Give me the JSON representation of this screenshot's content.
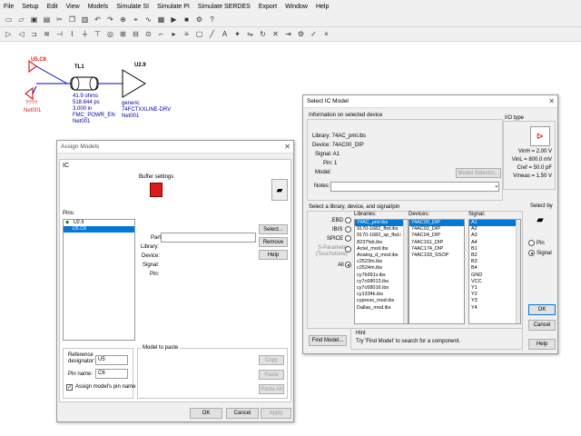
{
  "menu": [
    "File",
    "Setup",
    "Edit",
    "View",
    "Models",
    "Simulate SI",
    "Simulate PI",
    "Simulate SERDES",
    "Export",
    "Window",
    "Help"
  ],
  "schematic": {
    "u5c6": "U5.C6",
    "unknown": "????",
    "net_left": "Net001",
    "tl1": "TL1",
    "tl1_params": [
      "41.9 ohms",
      "518.644 ps",
      "3.000 in",
      "FMC_POWR_EN",
      "Net001"
    ],
    "u29": "U2.9",
    "u29_params": [
      "generic",
      "74FCTXXLINE-DRV",
      "Net001"
    ]
  },
  "assign": {
    "title": "Assign Models",
    "tab": "IC",
    "buffer_settings": "Buffer settings",
    "pins_label": "Pins:",
    "pins": [
      "U2.9",
      "U5.C6"
    ],
    "part": "Part:",
    "library": "Library:",
    "device": "Device:",
    "signal": "Signal:",
    "pin": "Pin:",
    "select_btn": "Select...",
    "remove_btn": "Remove",
    "help_btn": "Help",
    "ref_label": "Reference designator:",
    "ref_value": "U5",
    "pin_name_label": "Pin name:",
    "pin_name_value": "C6",
    "assign_chk": "Assign model's pin name",
    "model_to_paste": "Model to paste",
    "copy_btn": "Copy",
    "paste_btn": "Paste",
    "paste_all_btn": "Paste All",
    "ok": "OK",
    "cancel": "Cancel",
    "apply": "Apply"
  },
  "select": {
    "title": "Select IC Model",
    "info_header": "Information on selected device",
    "library": "Library: 74AC_pml.ibs",
    "device": "Device: 74AC00_DIP",
    "signal": "Signal: A1",
    "pin": "Pin: 1",
    "model": "Model:",
    "model_selector": "Model Selector...",
    "notes": "Notes:",
    "io_type": "I/O type",
    "io_vals": [
      "VinH = 2.00 V",
      "VinL = 800.0 mV",
      "Cref = 50.0 pF",
      "Vmeas = 1.50 V"
    ],
    "select_hdr": "Select a library, device, and signal/pin",
    "r_ebd": ".EBD",
    "r_ibis": "IBIS",
    "r_spice": "SPICE",
    "r_sparam": "S-Parameter",
    "r_touchstone": "(Touchstone)",
    "r_all": "All",
    "libraries_label": "Libraries:",
    "libraries": [
      "74AC_pml.ibs",
      "9170-1682_fbd.ibs",
      "9170-1682_sp_fbd.i",
      "8237fsb.ibs",
      "Actel_mod.ibs",
      "Analog_d_mod.ibs",
      "c2523m.ibs",
      "c2524m.ibs",
      "cy7b991v.ibs",
      "cy7c68013.ibs",
      "cy7c68016.ibs",
      "cy1334k.ibs",
      "cypress_mod.ibs",
      "Dallas_mod.ibs"
    ],
    "devices_label": "Devices:",
    "devices": [
      "74AC00_DIP",
      "74AC02_DIP",
      "74AC04_DIP",
      "74AC161_DIP",
      "74AC174_DIP",
      "74AC193_SSOP"
    ],
    "signal_label": "Signal:",
    "signals": [
      "A1",
      "A2",
      "A3",
      "A4",
      "B1",
      "B2",
      "B3",
      "B4",
      "GND",
      "VCC",
      "Y1",
      "Y2",
      "Y3",
      "Y4"
    ],
    "select_by": "Select by",
    "r_pin": "Pin",
    "r_signal": "Signal",
    "ok": "OK",
    "cancel": "Cancel",
    "help": "Help",
    "find_model": "Find Model...",
    "hint_title": "Hint",
    "hint": "Try 'Find Model' to search for a component."
  }
}
